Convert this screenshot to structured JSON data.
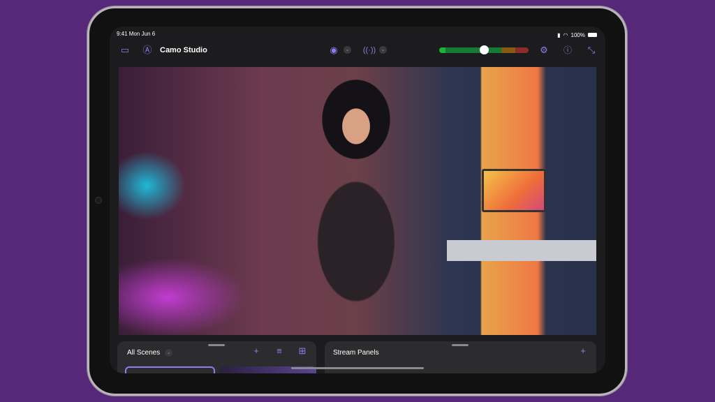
{
  "status_bar": {
    "time": "9:41 Mon Jun 6",
    "battery": "100%"
  },
  "toolbar": {
    "app_title": "Camo Studio",
    "audio_level_percent": 50,
    "colors": {
      "accent": "#8f7cf0"
    }
  },
  "scenes_panel": {
    "title": "All Scenes"
  },
  "stream_panel": {
    "title": "Stream Panels"
  }
}
